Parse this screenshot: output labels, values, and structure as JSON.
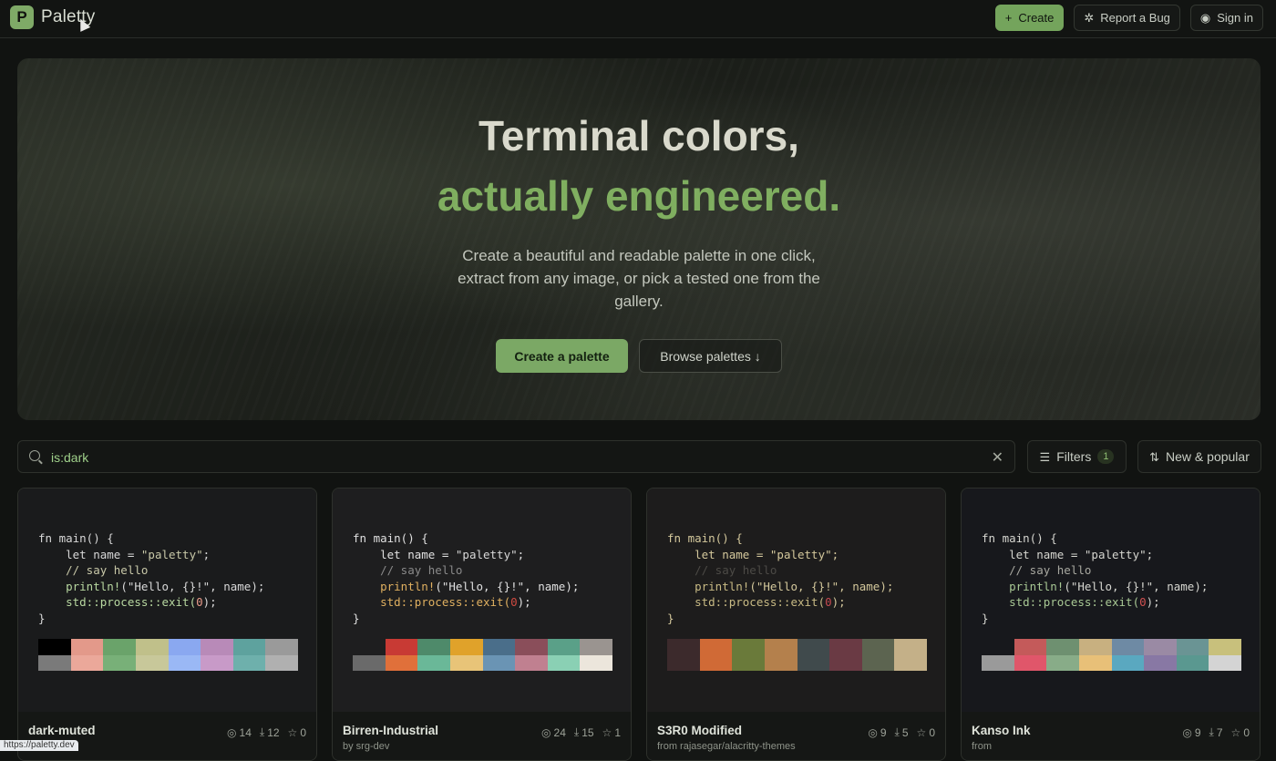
{
  "app": {
    "logo_letter": "P",
    "name": "Paletty"
  },
  "nav": {
    "create": "Create",
    "report_bug": "Report a Bug",
    "sign_in": "Sign in"
  },
  "hero": {
    "title_line1": "Terminal colors,",
    "title_line2": "actually engineered.",
    "subtitle": "Create a beautiful and readable palette in one click, extract from any image, or pick a tested one from the gallery.",
    "cta_primary": "Create a palette",
    "cta_secondary": "Browse palettes ↓"
  },
  "search": {
    "value": "is:dark"
  },
  "filters": {
    "label": "Filters",
    "count": "1"
  },
  "sort": {
    "label": "New & popular"
  },
  "code_lines": [
    "fn main() {",
    "    let name = \"paletty\";",
    "    // say hello",
    "    println!(\"Hello, {}!\", name);",
    "    std::process::exit(0);",
    "}"
  ],
  "cards": [
    {
      "title": "dark-muted",
      "author": "",
      "views": "14",
      "downloads": "12",
      "stars": "0",
      "bg": "#1a1b1c",
      "code_colors": {
        "base": "#d8d8d8",
        "comment": "#c8c8a8",
        "string": "#c8c8a8",
        "fn": "#b8d8a0",
        "num": "#e89a8a"
      },
      "swatch_top": [
        "#000000",
        "#e3998a",
        "#6aa36a",
        "#c0c08a",
        "#8aa8f0",
        "#b88ab8",
        "#5ea29e",
        "#9a9a9a"
      ],
      "swatch_bottom": [
        "#7a7a7a",
        "#eba89a",
        "#78b078",
        "#c8c89a",
        "#9ab8f5",
        "#c89ac8",
        "#6eb0ac",
        "#b0b0b0"
      ]
    },
    {
      "title": "Birren-Industrial",
      "author": "by srg-dev",
      "views": "24",
      "downloads": "15",
      "stars": "1",
      "bg": "#1e1e1f",
      "code_colors": {
        "base": "#e0e0e0",
        "comment": "#8a8a8a",
        "string": "#d8d8d8",
        "fn": "#e0b060",
        "num": "#d04a40"
      },
      "swatch_top": [
        "#1e1e1f",
        "#c83a34",
        "#4e8a6a",
        "#e0a22a",
        "#4a6e8a",
        "#8a4e5a",
        "#5aa088",
        "#9a9490"
      ],
      "swatch_bottom": [
        "#6a6a6a",
        "#e0703a",
        "#6ab898",
        "#e8c478",
        "#6a94b4",
        "#c08090",
        "#8ad0b4",
        "#ece6dc"
      ]
    },
    {
      "title": "S3R0 Modified",
      "author": "from rajasegar/alacritty-themes",
      "views": "9",
      "downloads": "5",
      "stars": "0",
      "bg": "#1d1c1c",
      "code_colors": {
        "base": "#d4c89c",
        "comment": "#4c4a46",
        "string": "#d4c89c",
        "fn": "#c8ba84",
        "num": "#c44a50"
      },
      "swatch_top": [
        "#3c2a2c",
        "#d06a36",
        "#6a7a3a",
        "#b4804c",
        "#404a4c",
        "#6a3a44",
        "#5c6450",
        "#c4b088"
      ],
      "swatch_bottom": []
    },
    {
      "title": "Kanso Ink",
      "author": "from",
      "views": "9",
      "downloads": "7",
      "stars": "0",
      "bg": "#17181c",
      "code_colors": {
        "base": "#d6d6d0",
        "comment": "#a8a8a0",
        "string": "#d6d6d0",
        "fn": "#a8c894",
        "num": "#d05050"
      },
      "swatch_top": [
        "#17181c",
        "#c45a5a",
        "#6e9070",
        "#c8b080",
        "#6e8aa4",
        "#9a8aa4",
        "#6a9494",
        "#c8c07c"
      ],
      "swatch_bottom": [
        "#9a9a9a",
        "#e0566a",
        "#88ac88",
        "#e8c078",
        "#5aa8c0",
        "#8878a4",
        "#5a9890",
        "#d4d4d4"
      ]
    }
  ],
  "status_url": "https://paletty.dev"
}
